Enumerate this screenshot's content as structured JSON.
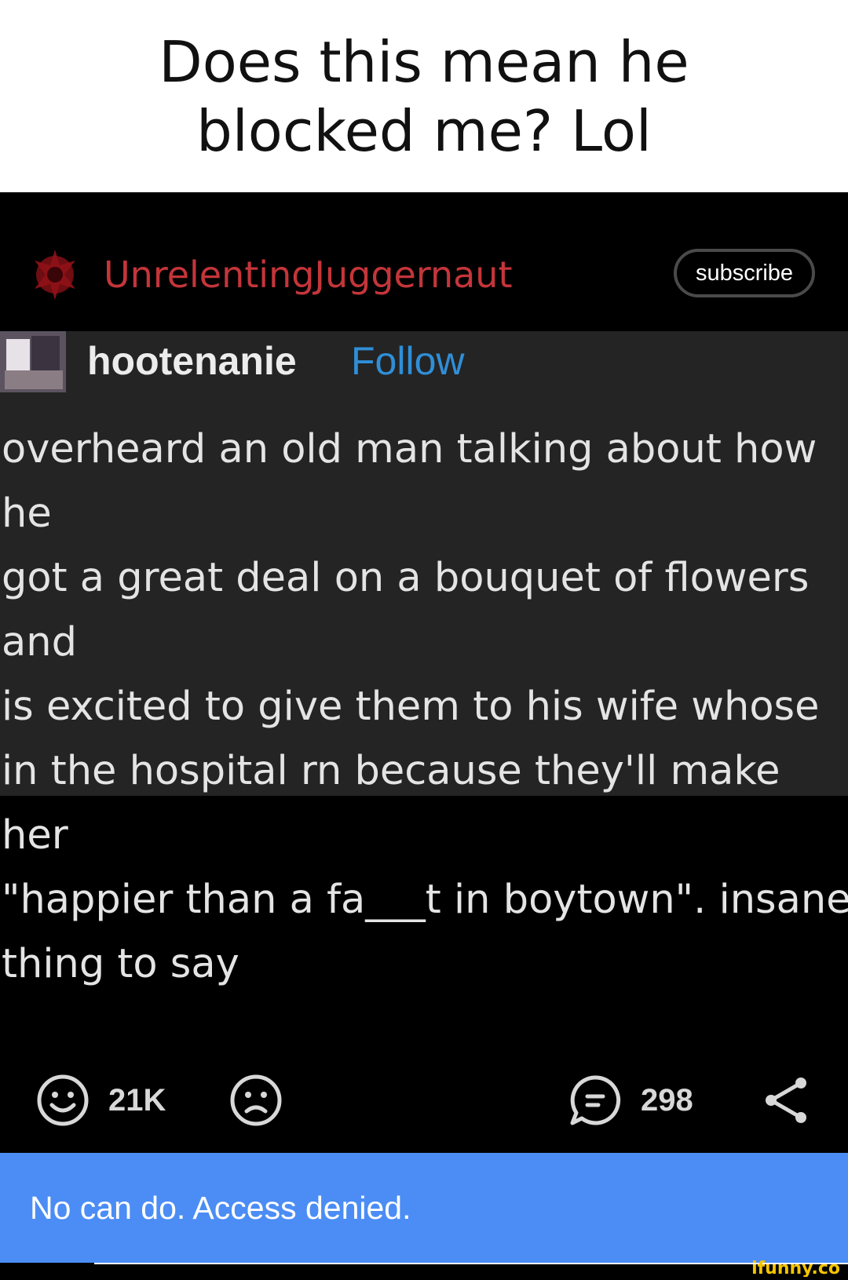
{
  "caption": {
    "text": "Does this mean he blocked me? Lol"
  },
  "post_header": {
    "author": "UnrelentingJuggernaut",
    "subscribe_label": "subscribe",
    "author_color": "#c4353a"
  },
  "post": {
    "username": "hootenanie",
    "follow_label": "Follow",
    "body": "overheard an old man talking about how he\ngot a great deal on a bouquet of flowers and\nis excited to give them to his wife whose\nin the hospital rn because they'll make her\n\"happier than a fa___t in boytown\". insane\nthing to say"
  },
  "actions": {
    "smile_count": "21K",
    "comment_count": "298",
    "icons": [
      "smile-icon",
      "frown-icon",
      "comment-icon",
      "share-icon"
    ]
  },
  "toast": {
    "message": "No can do. Access denied.",
    "color": "#4b8df5"
  },
  "watermark": {
    "text": "ifunny.co"
  }
}
